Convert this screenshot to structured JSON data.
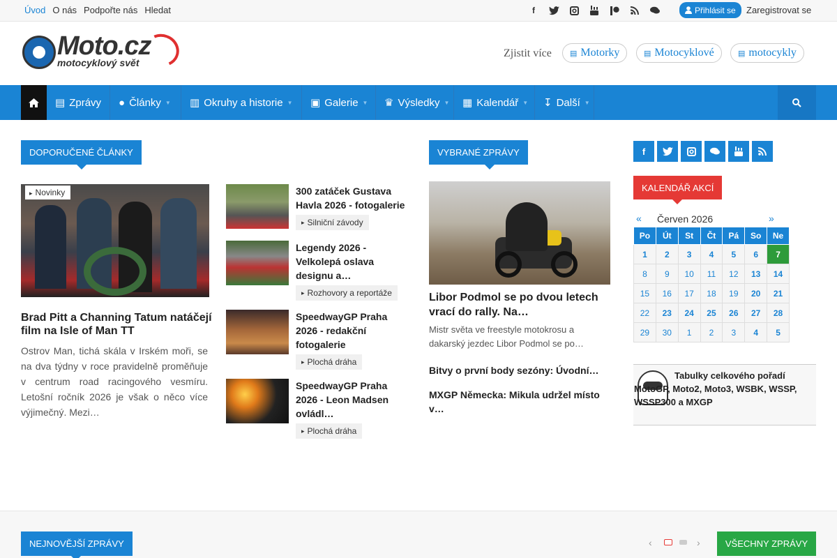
{
  "topnav": [
    {
      "label": "Úvod",
      "active": true
    },
    {
      "label": "O nás"
    },
    {
      "label": "Podpořte nás"
    },
    {
      "label": "Hledat"
    }
  ],
  "top_social_icons": [
    "facebook-icon",
    "twitter-icon",
    "instagram-icon",
    "youtube-icon",
    "patreon-icon",
    "rss-icon",
    "chat-icon"
  ],
  "auth": {
    "login": "Přihlásit se",
    "register": "Zaregistrovat se"
  },
  "logo": {
    "title": "Moto.cz",
    "subtitle": "motocyklový svět"
  },
  "header": {
    "learn_more": "Zjistit více",
    "tags": [
      "Motorky",
      "Motocyklové",
      "motocykly"
    ]
  },
  "mainnav": {
    "items": [
      {
        "label": "Zprávy",
        "icon": "newspaper-icon",
        "dropdown": false
      },
      {
        "label": "Články",
        "icon": "globe-icon",
        "dropdown": true
      },
      {
        "label": "Okruhy a historie",
        "icon": "bar-chart-icon",
        "dropdown": true
      },
      {
        "label": "Galerie",
        "icon": "image-icon",
        "dropdown": true
      },
      {
        "label": "Výsledky",
        "icon": "trophy-icon",
        "dropdown": true
      },
      {
        "label": "Kalendář",
        "icon": "calendar-icon",
        "dropdown": true
      },
      {
        "label": "Další",
        "icon": "arrow-down-icon",
        "dropdown": true
      }
    ]
  },
  "recommended": {
    "label": "Doporučené články",
    "featured": {
      "category": "Novinky",
      "title": "Brad Pitt a Channing Tatum natáčejí film na Isle of Man TT",
      "excerpt": "Ostrov Man, tichá skála v Irském moři, se na dva týdny v roce pravidelně proměňuje v centrum road racingového vesmíru. Letošní ročník 2026 je však o něco více výjimečný. Mezi…"
    },
    "list": [
      {
        "title": "300 zatáček Gustava Havla 2026 - fotogalerie",
        "category": "Silniční závody"
      },
      {
        "title": "Legendy 2026 - Velkolepá oslava designu a…",
        "category": "Rozhovory a reportáže"
      },
      {
        "title": "SpeedwayGP Praha 2026 - redakční fotogalerie",
        "category": "Plochá dráha"
      },
      {
        "title": "SpeedwayGP Praha 2026 - Leon Madsen ovládl…",
        "category": "Plochá dráha"
      }
    ]
  },
  "selected_news": {
    "label": "Vybrané zprávy",
    "main": {
      "title": "Libor Podmol se po dvou letech vrací do rally. Na…",
      "excerpt": "Mistr světa ve freestyle motokrosu a dakarský jezdec Libor Podmol se po…"
    },
    "links": [
      "Bitvy o první body sezóny: Úvodní…",
      "MXGP Německa: Mikula udržel místo v…"
    ]
  },
  "sidebar": {
    "social_icons": [
      "facebook-icon",
      "twitter-icon",
      "instagram-icon",
      "chat-icon",
      "youtube-icon",
      "rss-icon"
    ],
    "calendar": {
      "label": "Kalendář akcí",
      "prev": "«",
      "next": "»",
      "month": "Červen 2026",
      "weekdays": [
        "Po",
        "Út",
        "St",
        "Čt",
        "Pá",
        "So",
        "Ne"
      ],
      "weeks": [
        [
          {
            "d": "1",
            "ev": true
          },
          {
            "d": "2",
            "ev": true
          },
          {
            "d": "3",
            "ev": true
          },
          {
            "d": "4",
            "ev": true
          },
          {
            "d": "5",
            "ev": true
          },
          {
            "d": "6",
            "ev": true
          },
          {
            "d": "7",
            "today": true
          }
        ],
        [
          {
            "d": "8"
          },
          {
            "d": "9"
          },
          {
            "d": "10"
          },
          {
            "d": "11"
          },
          {
            "d": "12"
          },
          {
            "d": "13",
            "ev": true
          },
          {
            "d": "14",
            "ev": true
          }
        ],
        [
          {
            "d": "15"
          },
          {
            "d": "16"
          },
          {
            "d": "17"
          },
          {
            "d": "18"
          },
          {
            "d": "19"
          },
          {
            "d": "20",
            "ev": true
          },
          {
            "d": "21",
            "ev": true
          }
        ],
        [
          {
            "d": "22"
          },
          {
            "d": "23",
            "ev": true
          },
          {
            "d": "24",
            "ev": true
          },
          {
            "d": "25",
            "ev": true
          },
          {
            "d": "26",
            "ev": true
          },
          {
            "d": "27",
            "ev": true
          },
          {
            "d": "28",
            "ev": true
          }
        ],
        [
          {
            "d": "29"
          },
          {
            "d": "30"
          },
          {
            "d": "1",
            "other": true
          },
          {
            "d": "2",
            "other": true
          },
          {
            "d": "3",
            "other": true
          },
          {
            "d": "4",
            "other": true,
            "ev": true
          },
          {
            "d": "5",
            "other": true,
            "ev": true
          }
        ]
      ]
    },
    "standings": "Tabulky celkového pořadí MotoGP, Moto2, Moto3, WSBK, WSSP, WSSP300 a MXGP"
  },
  "latest": {
    "label": "Nejnovější zprávy",
    "all_button": "Všechny zprávy"
  },
  "colors": {
    "accent": "#1a84d4",
    "calendar_label": "#e53935",
    "today": "#2e9b3a",
    "all_news": "#28a745"
  }
}
